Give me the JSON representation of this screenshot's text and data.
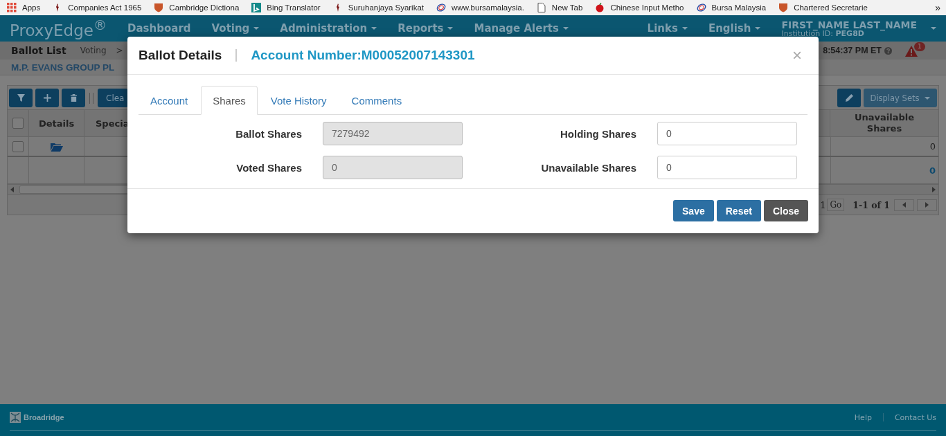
{
  "bookmarks": [
    {
      "label": "Apps",
      "kind": "apps"
    },
    {
      "label": "Companies Act 1965",
      "kind": "figure"
    },
    {
      "label": "Cambridge Dictiona",
      "kind": "shield"
    },
    {
      "label": "Bing Translator",
      "kind": "letter"
    },
    {
      "label": "Suruhanjaya Syarikat",
      "kind": "figure"
    },
    {
      "label": "www.bursamalaysia.",
      "kind": "globe"
    },
    {
      "label": "New Tab",
      "kind": "page"
    },
    {
      "label": "Chinese Input Metho",
      "kind": "fruit"
    },
    {
      "label": "Bursa Malaysia",
      "kind": "globe"
    },
    {
      "label": "Chartered Secretarie",
      "kind": "shield"
    }
  ],
  "bookmarks_more": "»",
  "nav": {
    "logo": "ProxyEdge$^{®}$",
    "items": [
      {
        "label": "Dashboard",
        "dropdown": false
      },
      {
        "label": "Voting",
        "dropdown": true
      },
      {
        "label": "Administration",
        "dropdown": true
      },
      {
        "label": "Reports",
        "dropdown": true
      },
      {
        "label": "Manage Alerts",
        "dropdown": true
      }
    ],
    "right_items": [
      {
        "label": "Links",
        "dropdown": true
      },
      {
        "label": "English",
        "dropdown": true
      }
    ],
    "user": {
      "name": "FIRST_NAME LAST_NAME",
      "institution": "Institution ID: **PEG8D**"
    }
  },
  "subheader": {
    "title": "Ballot List",
    "breadcrumb": "Voting",
    "breadcrumb_sep": ">",
    "time": "8:54:37 PM ET",
    "alert_count": "1"
  },
  "company": "M.P. EVANS GROUP PL",
  "toolbar": {
    "clear": "Clea",
    "display_sets": "Display Sets"
  },
  "table": {
    "columns": [
      "Details",
      "Specia"
    ],
    "right_column": "Unavailable Shares",
    "rows": [
      {
        "kind": "item",
        "checked": false,
        "value": "0"
      },
      {
        "kind": "total",
        "value": "0"
      }
    ],
    "header_checked": false
  },
  "pager": {
    "page": "1",
    "go": "Go",
    "range": "1-1 of 1"
  },
  "modal": {
    "title": "Ballot Details",
    "subtitle": "Account Number:M00052007143301",
    "close": "×",
    "tabs": [
      {
        "label": "Account",
        "selected": false
      },
      {
        "label": "Shares",
        "selected": true
      },
      {
        "label": "Vote History",
        "selected": false
      },
      {
        "label": "Comments",
        "selected": false
      }
    ],
    "fields": [
      {
        "label": "Ballot Shares",
        "value": "7279492",
        "disabled": true
      },
      {
        "label": "Holding Shares",
        "value": "0",
        "disabled": false
      },
      {
        "label": "Voted Shares",
        "value": "0",
        "disabled": true
      },
      {
        "label": "Unavailable Shares",
        "value": "0",
        "disabled": false
      }
    ],
    "buttons": [
      {
        "label": "Save",
        "kind": "primary"
      },
      {
        "label": "Reset",
        "kind": "primary"
      },
      {
        "label": "Close",
        "kind": "dark"
      }
    ]
  },
  "footer": {
    "brand": "Broadridge",
    "links": [
      "Help",
      "Contact Us"
    ]
  }
}
